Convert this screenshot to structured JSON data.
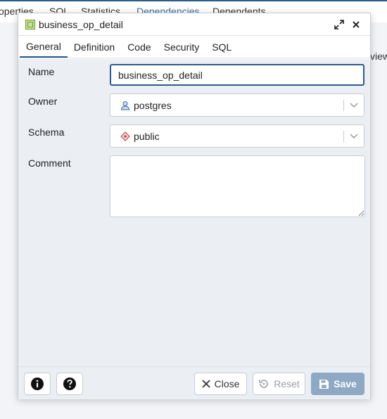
{
  "background": {
    "tabs": [
      "operties",
      "SQL",
      "Statistics",
      "Dependencies",
      "Dependents"
    ],
    "side_text": "view"
  },
  "dialog": {
    "title": "business_op_detail",
    "tabs": [
      {
        "label": "General",
        "active": true
      },
      {
        "label": "Definition",
        "active": false
      },
      {
        "label": "Code",
        "active": false
      },
      {
        "label": "Security",
        "active": false
      },
      {
        "label": "SQL",
        "active": false
      }
    ],
    "form": {
      "name_label": "Name",
      "name_value": "business_op_detail",
      "owner_label": "Owner",
      "owner_value": "postgres",
      "schema_label": "Schema",
      "schema_value": "public",
      "comment_label": "Comment",
      "comment_value": ""
    },
    "footer": {
      "close_label": "Close",
      "reset_label": "Reset",
      "save_label": "Save"
    }
  },
  "colors": {
    "accent": "#2a5c8c",
    "save_button": "#8ea9c4"
  }
}
